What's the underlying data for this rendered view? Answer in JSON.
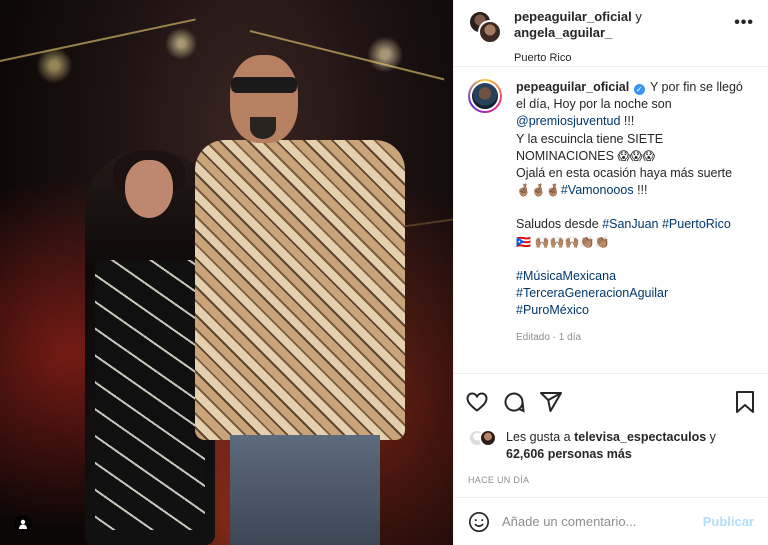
{
  "header": {
    "user1": "pepeaguilar_oficial",
    "joiner": "y",
    "user2": "angela_aguilar_",
    "location": "Puerto Rico",
    "more_icon": "ellipsis-icon",
    "more_label": "•••"
  },
  "caption": {
    "username": "pepeaguilar_oficial",
    "verified_mark": "✓",
    "line1": "Y por fin se llegó el día, Hoy por la noche son",
    "mention": "@premiosjuventud",
    "mention_suffix": "!!!",
    "line2": "Y la escuincla tiene SIETE NOMINACIONES",
    "emoji1": "😱😱😱",
    "line3": "Ojalá en esta ocasión haya más suerte",
    "emoji2": "🤞🏽🤞🏽🤞🏽",
    "hashtag_vamonos": "#Vamonooos",
    "vamonos_suffix": "!!!",
    "greeting": "Saludos desde",
    "hashtag_sanjuan": "#SanJuan",
    "hashtag_pr": "#PuertoRico",
    "emoji3": "🇵🇷 🙌🏽🙌🏽🙌🏽👏🏽👏🏽",
    "hashtag_musica": "#MúsicaMexicana",
    "hashtag_tercera": "#TerceraGeneracionAguilar",
    "hashtag_puro": "#PuroMéxico",
    "edited": "Editado · 1 día"
  },
  "actions": {
    "like_icon": "heart-icon",
    "comment_icon": "comment-icon",
    "share_icon": "share-icon",
    "save_icon": "bookmark-icon"
  },
  "likes": {
    "prefix": "Les gusta a",
    "liker": "televisa_espectaculos",
    "joiner": "y",
    "count_text": "62,606 personas más"
  },
  "timeago": "HACE UN DÍA",
  "comment_box": {
    "placeholder": "Añade un comentario...",
    "post_label": "Publicar",
    "emoji_icon": "smiley-icon"
  },
  "photo": {
    "tag_icon": "user-tag-icon"
  },
  "colors": {
    "link": "#00376b",
    "verified": "#3897f0",
    "post_button_disabled": "#b2dffc",
    "muted": "#8e8e8e"
  }
}
